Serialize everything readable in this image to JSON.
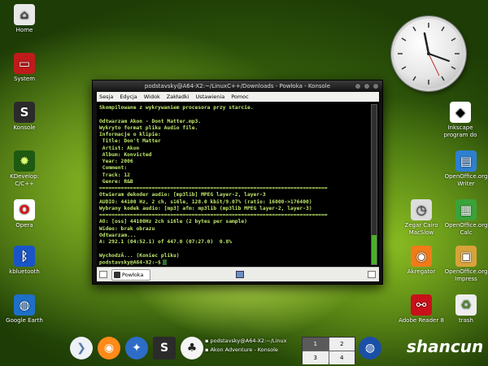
{
  "desktop_icons_left": [
    {
      "label": "Home",
      "icon": "home-folder-icon",
      "glyph": "⌂",
      "bg": "#e8e8e8",
      "fg": "#444"
    },
    {
      "label": "System",
      "icon": "system-icon",
      "glyph": "▭",
      "bg": "#c01b1b",
      "fg": "#fff"
    },
    {
      "label": "Konsole",
      "icon": "konsole-icon",
      "glyph": "S",
      "bg": "#2b2b2b",
      "fg": "#fff"
    },
    {
      "label": "KDevelop: C/C++",
      "icon": "kdevelop-icon",
      "glyph": "✹",
      "bg": "#1f5a12",
      "fg": "#d8ff70"
    },
    {
      "label": "Opera",
      "icon": "opera-icon",
      "glyph": "O",
      "bg": "#ffffff",
      "fg": "#d11"
    },
    {
      "label": "kbluetooth",
      "icon": "bluetooth-icon",
      "glyph": "ᛒ",
      "bg": "#1a55c8",
      "fg": "#fff"
    },
    {
      "label": "Google Earth",
      "icon": "google-earth-icon",
      "glyph": "◍",
      "bg": "#1e6fc8",
      "fg": "#fff"
    }
  ],
  "desktop_icons_right": [
    {
      "label": "Inkscape program do",
      "icon": "inkscape-icon",
      "glyph": "◆",
      "bg": "#ffffff",
      "fg": "#000"
    },
    {
      "label": "OpenOffice.org Writer",
      "icon": "openoffice-writer-icon",
      "glyph": "▤",
      "bg": "#2e7fd0",
      "fg": "#fff"
    },
    {
      "label": "OpenOffice.org Calc",
      "icon": "openoffice-calc-icon",
      "glyph": "▦",
      "bg": "#3aa33a",
      "fg": "#fff"
    },
    {
      "label": "Zegar Cairo MacSlow",
      "icon": "clock-app-icon",
      "glyph": "◷",
      "bg": "#dddddd",
      "fg": "#333"
    },
    {
      "label": "Akregator",
      "icon": "akregator-rss-icon",
      "glyph": "◉",
      "bg": "#f07b1a",
      "fg": "#fff"
    },
    {
      "label": "OpenOffice.org Impress",
      "icon": "openoffice-impress-icon",
      "glyph": "▣",
      "bg": "#d8a33a",
      "fg": "#fff"
    },
    {
      "label": "Adobe Reader 8",
      "icon": "adobe-reader-icon",
      "glyph": "⚯",
      "bg": "#c8101a",
      "fg": "#fff"
    },
    {
      "label": "trash",
      "icon": "trash-icon",
      "glyph": "♻",
      "bg": "#eeeeee",
      "fg": "#4a8a2a"
    }
  ],
  "terminal_window": {
    "title": "podstavsky@A64-X2:~/LinuxC++/Downloads - Powłoka - Konsole",
    "menu": [
      "Sesja",
      "Edycja",
      "Widok",
      "Zakładki",
      "Ustawienia",
      "Pomoc"
    ],
    "lines": [
      "Skompilowane z wykrywaniem procesora przy starcie.",
      "",
      "Odtwarzam Akon - Dont Matter.mp3.",
      "Wykryto format pliku Audio file.",
      "Informacje o klipie:",
      " Title: Don't Matter",
      " Artist: Akon",
      " Album: Konvicted",
      " Year: 2006",
      " Comment:",
      " Track: 12",
      " Genre: R&B",
      "==========================================================================",
      "Otwieram dekoder audio: [mp3lib] MPEG layer-2, layer-3",
      "AUDIO: 44100 Hz, 2 ch, s16le, 128.0 kbit/9.07% (ratio: 16000->176400)",
      "Wybrany kodek audio: [mp3] afm: mp3lib (mp3lib MPEG layer-2, layer-3)",
      "==========================================================================",
      "AO: [oss] 44100Hz 2ch s16le (2 bytes per sample)",
      "Wideo: brak obrazu",
      "Odtwarzam...",
      "A: 292.1 (04:52.1) of 447.0 (07:27.0)  0.8%",
      "",
      "WychodzĂ... (Koniec pliku)"
    ],
    "prompt": "podstavsky@A64-X2:~$",
    "tab_label": "Powłoka"
  },
  "taskbar": {
    "window_list": [
      "podstavsky@A64-X2:~/Linux",
      "Akon Adventure - Konsole"
    ],
    "pager": [
      "1",
      "2",
      "3",
      "4"
    ],
    "active_desktop": "1"
  },
  "watermark": "shancun"
}
